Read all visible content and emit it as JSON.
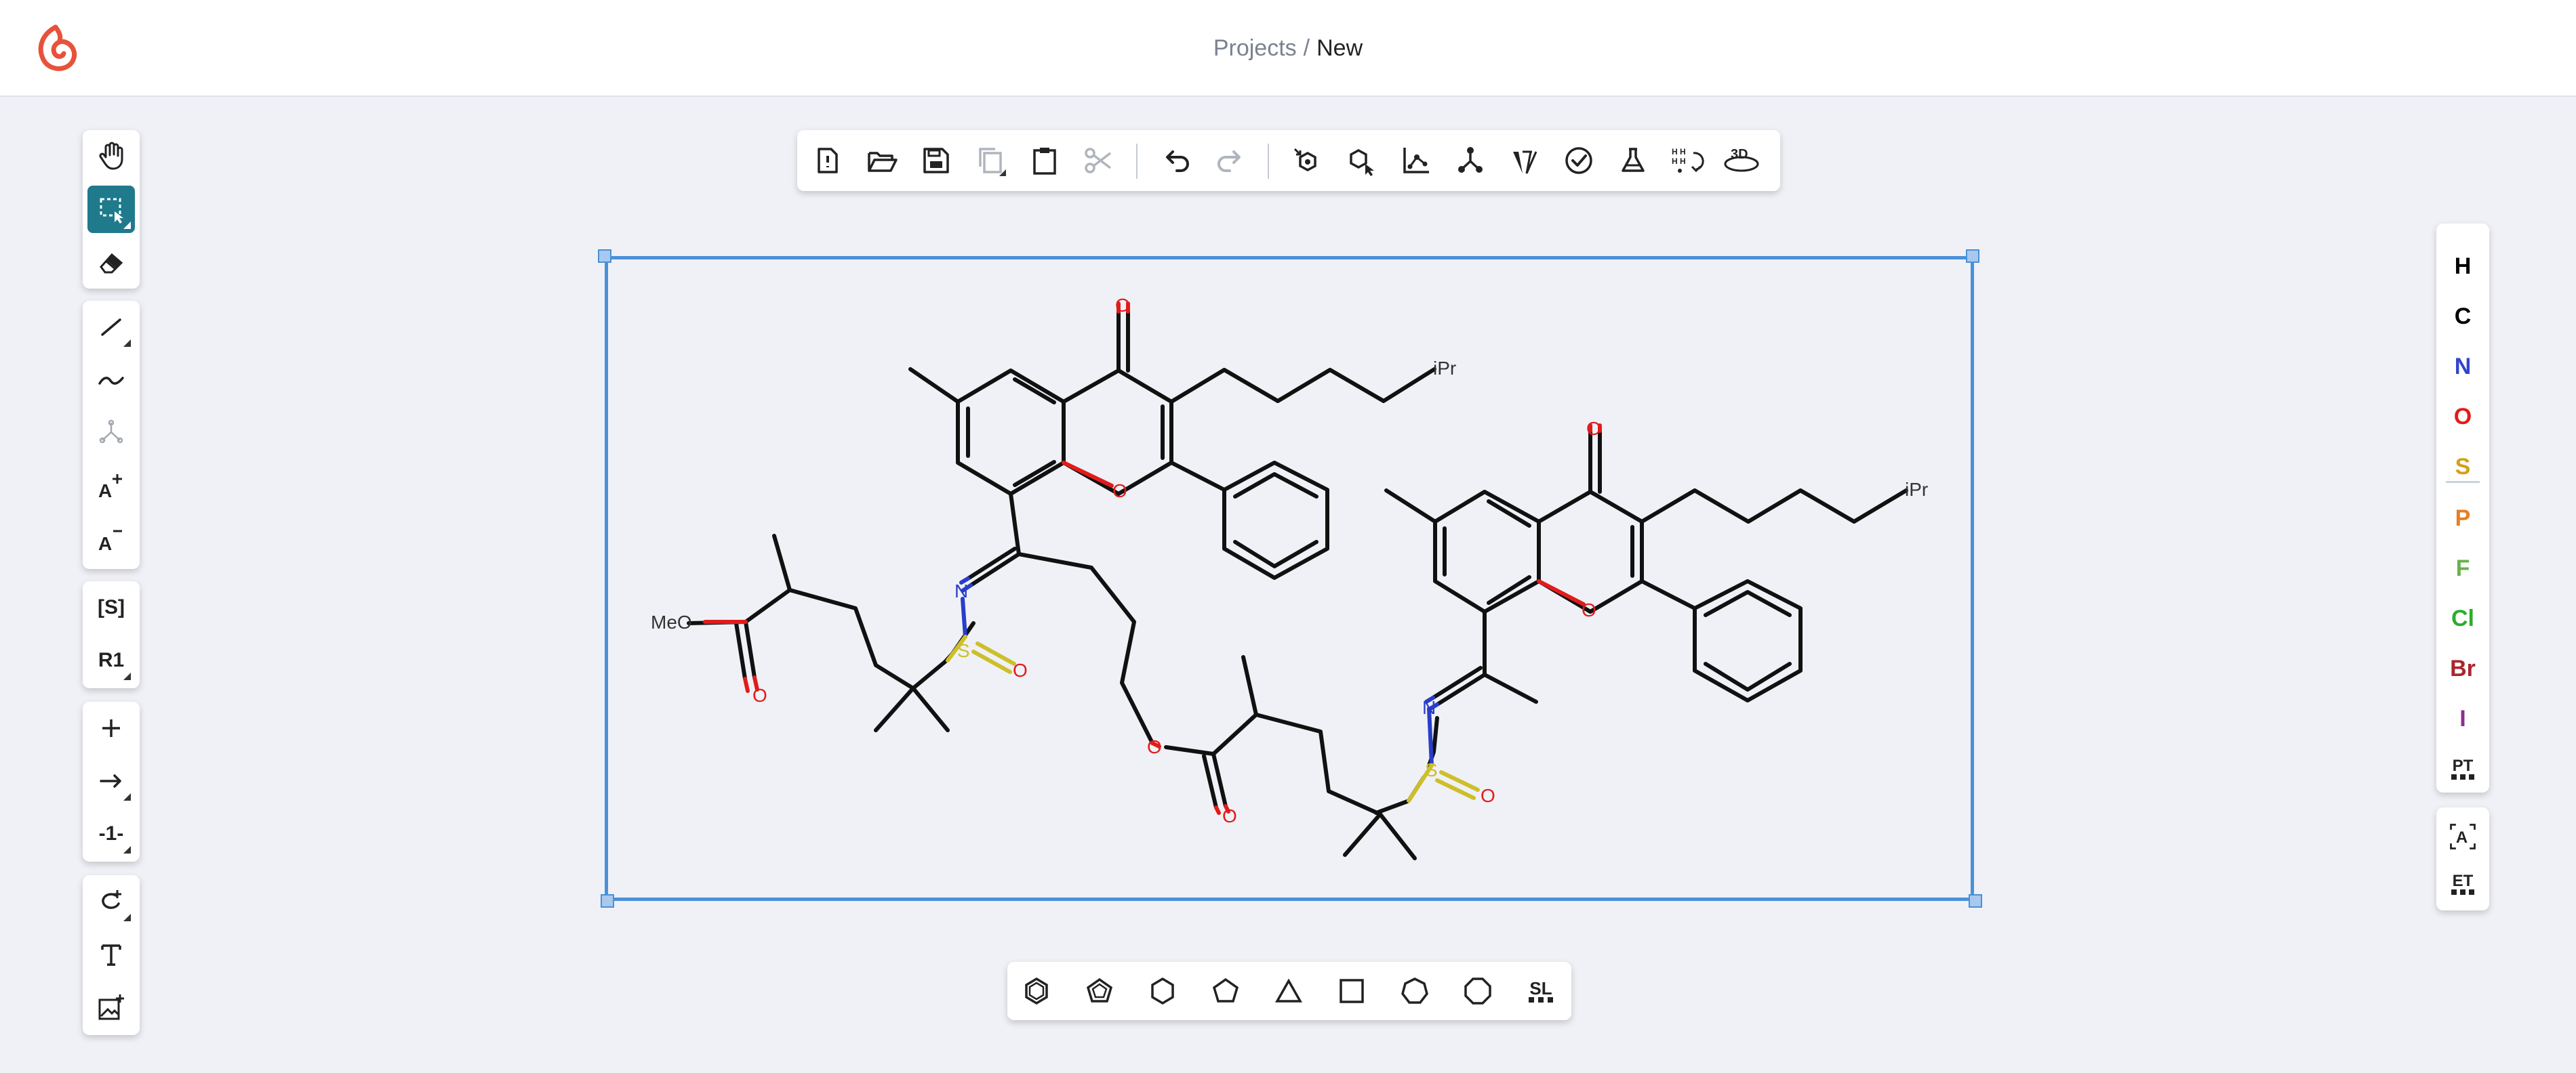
{
  "header": {
    "breadcrumb_parent": "Projects",
    "breadcrumb_separator": "/",
    "breadcrumb_current": "New",
    "brand_color": "#e8513a"
  },
  "left_toolbar": {
    "groups": [
      [
        "hand-tool",
        "select-rectangle-tool",
        "erase-tool"
      ],
      [
        "single-bond-tool",
        "chain-tool",
        "monomer-tool",
        "charge-plus-tool",
        "charge-minus-tool"
      ],
      [
        "sgroup-tool",
        "rgroup-tool"
      ],
      [
        "reaction-plus-tool",
        "reaction-arrow-tool",
        "reaction-mapping-tool"
      ],
      [
        "rotate-tool",
        "text-tool",
        "add-image-tool"
      ]
    ],
    "sgroup_label": "[S]",
    "rgroup_label": "R1",
    "mapping_label": "-1-",
    "active_tool": "select-rectangle-tool",
    "active_color": "#1f7a8c"
  },
  "top_toolbar": {
    "tools": [
      "new-file",
      "open",
      "save",
      "copy",
      "paste",
      "cut",
      "undo",
      "redo",
      "layout",
      "clean-up",
      "aromatize",
      "dearomatize",
      "calculate-cip",
      "check-structure",
      "analyse",
      "explicit-hydrogens",
      "3d-viewer"
    ],
    "three_d_label": "3D"
  },
  "right_toolbar": {
    "atoms": [
      {
        "symbol": "H",
        "color": "#000000"
      },
      {
        "symbol": "C",
        "color": "#000000"
      },
      {
        "symbol": "N",
        "color": "#3344cc"
      },
      {
        "symbol": "O",
        "color": "#e21b1b"
      },
      {
        "symbol": "S",
        "color": "#d4a017"
      },
      {
        "symbol": "P",
        "color": "#e67e22"
      },
      {
        "symbol": "F",
        "color": "#6ab04c"
      },
      {
        "symbol": "Cl",
        "color": "#2bad2b"
      },
      {
        "symbol": "Br",
        "color": "#a8272c"
      },
      {
        "symbol": "I",
        "color": "#8e2d8e"
      }
    ],
    "periodic_table_label": "PT",
    "any_atom_label": "A",
    "extended_table_label": "ET"
  },
  "bottom_toolbar": {
    "templates": [
      "benzene",
      "cyclopentadiene",
      "cyclohexane",
      "cyclopentane",
      "cyclopropane",
      "cyclobutane",
      "cycloheptane",
      "cyclooctane",
      "structure-library"
    ],
    "library_label": "SL"
  },
  "molecule_labels": {
    "ipr": "iPr",
    "methoxy": "MeO",
    "oxygen": "O",
    "nitrogen": "N",
    "sulfur": "S"
  }
}
